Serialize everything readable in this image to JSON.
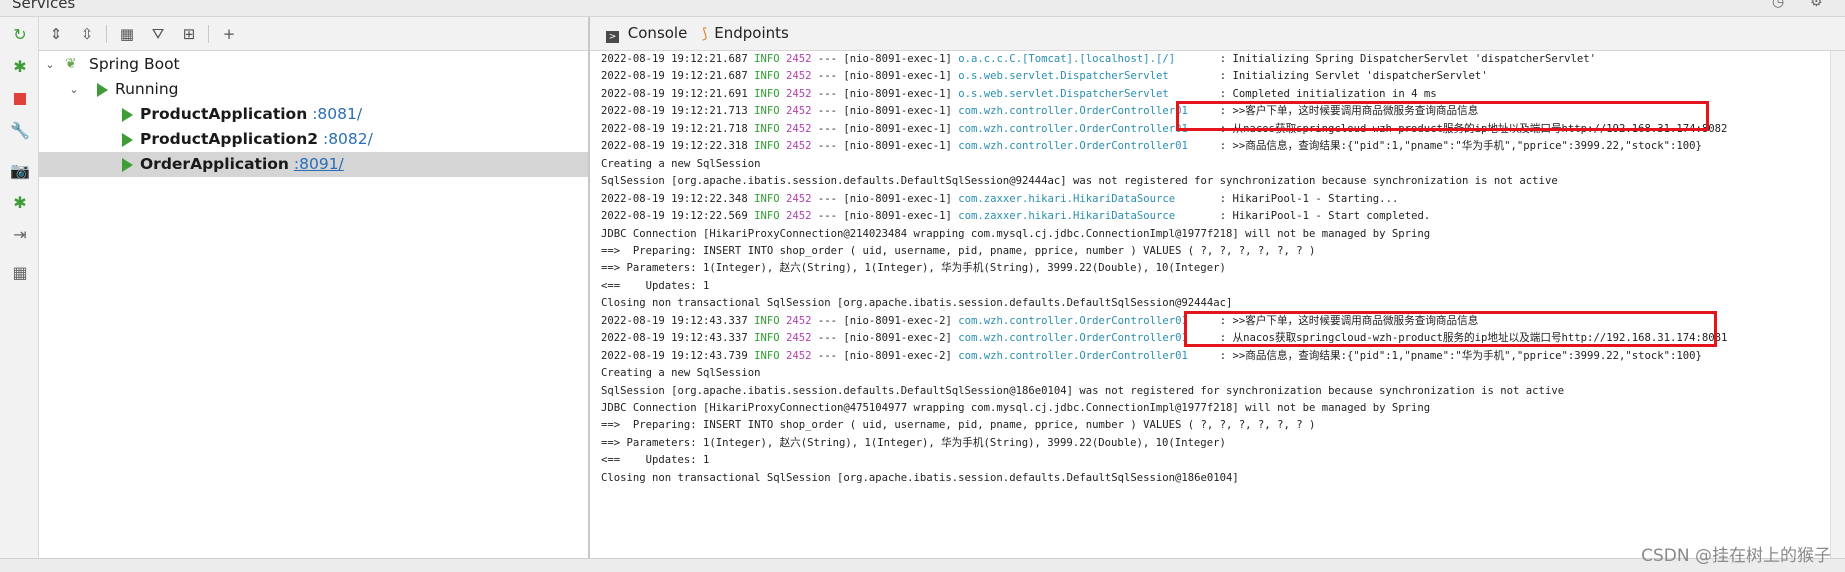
{
  "window": {
    "title": "Services"
  },
  "tree": {
    "root": {
      "label": "Spring Boot"
    },
    "group": {
      "label": "Running"
    },
    "apps": [
      {
        "name": "ProductApplication",
        "port": ":8081/"
      },
      {
        "name": "ProductApplication2",
        "port": ":8082/"
      },
      {
        "name": "OrderApplication",
        "port": ":8091/"
      }
    ]
  },
  "tabs": {
    "console": "Console",
    "endpoints": "Endpoints"
  },
  "log": [
    {
      "ts": "2022-08-19 19:12:21.687",
      "lvl": "INFO",
      "pid": "2452",
      "thr": "--- [nio-8091-exec-1]",
      "logger": "o.a.c.c.C.[Tomcat].[localhost].[/]      ",
      "msg": " : Initializing Spring DispatcherServlet 'dispatcherServlet'"
    },
    {
      "ts": "2022-08-19 19:12:21.687",
      "lvl": "INFO",
      "pid": "2452",
      "thr": "--- [nio-8091-exec-1]",
      "logger": "o.s.web.servlet.DispatcherServlet       ",
      "msg": " : Initializing Servlet 'dispatcherServlet'"
    },
    {
      "ts": "2022-08-19 19:12:21.691",
      "lvl": "INFO",
      "pid": "2452",
      "thr": "--- [nio-8091-exec-1]",
      "logger": "o.s.web.servlet.DispatcherServlet       ",
      "msg": " : Completed initialization in 4 ms"
    },
    {
      "ts": "2022-08-19 19:12:21.713",
      "lvl": "INFO",
      "pid": "2452",
      "thr": "--- [nio-8091-exec-1]",
      "logger": "com.wzh.controller.OrderController01    ",
      "msg": " : >>客户下单，这时候要调用商品微服务查询商品信息"
    },
    {
      "ts": "2022-08-19 19:12:21.718",
      "lvl": "INFO",
      "pid": "2452",
      "thr": "--- [nio-8091-exec-1]",
      "logger": "com.wzh.controller.OrderController01    ",
      "msg": " : 从nacos获取springcloud-wzh-product服务的ip地址以及端口号http://192.168.31.174:8082"
    },
    {
      "ts": "2022-08-19 19:12:22.318",
      "lvl": "INFO",
      "pid": "2452",
      "thr": "--- [nio-8091-exec-1]",
      "logger": "com.wzh.controller.OrderController01    ",
      "msg": " : >>商品信息，查询结果:{\"pid\":1,\"pname\":\"华为手机\",\"pprice\":3999.22,\"stock\":100}"
    },
    {
      "text": "Creating a new SqlSession"
    },
    {
      "text": "SqlSession [org.apache.ibatis.session.defaults.DefaultSqlSession@92444ac] was not registered for synchronization because synchronization is not active"
    },
    {
      "ts": "2022-08-19 19:12:22.348",
      "lvl": "INFO",
      "pid": "2452",
      "thr": "--- [nio-8091-exec-1]",
      "logger": "com.zaxxer.hikari.HikariDataSource      ",
      "msg": " : HikariPool-1 - Starting..."
    },
    {
      "ts": "2022-08-19 19:12:22.569",
      "lvl": "INFO",
      "pid": "2452",
      "thr": "--- [nio-8091-exec-1]",
      "logger": "com.zaxxer.hikari.HikariDataSource      ",
      "msg": " : HikariPool-1 - Start completed."
    },
    {
      "text": "JDBC Connection [HikariProxyConnection@214023484 wrapping com.mysql.cj.jdbc.ConnectionImpl@1977f218] will not be managed by Spring"
    },
    {
      "text": "==>  Preparing: INSERT INTO shop_order ( uid, username, pid, pname, pprice, number ) VALUES ( ?, ?, ?, ?, ?, ? )"
    },
    {
      "text": "==> Parameters: 1(Integer), 赵六(String), 1(Integer), 华为手机(String), 3999.22(Double), 10(Integer)"
    },
    {
      "text": "<==    Updates: 1"
    },
    {
      "text": "Closing non transactional SqlSession [org.apache.ibatis.session.defaults.DefaultSqlSession@92444ac]"
    },
    {
      "ts": "2022-08-19 19:12:43.337",
      "lvl": "INFO",
      "pid": "2452",
      "thr": "--- [nio-8091-exec-2]",
      "logger": "com.wzh.controller.OrderController01    ",
      "msg": " : >>客户下单，这时候要调用商品微服务查询商品信息"
    },
    {
      "ts": "2022-08-19 19:12:43.337",
      "lvl": "INFO",
      "pid": "2452",
      "thr": "--- [nio-8091-exec-2]",
      "logger": "com.wzh.controller.OrderController01    ",
      "msg": " : 从nacos获取springcloud-wzh-product服务的ip地址以及端口号http://192.168.31.174:8081"
    },
    {
      "ts": "2022-08-19 19:12:43.739",
      "lvl": "INFO",
      "pid": "2452",
      "thr": "--- [nio-8091-exec-2]",
      "logger": "com.wzh.controller.OrderController01    ",
      "msg": " : >>商品信息，查询结果:{\"pid\":1,\"pname\":\"华为手机\",\"pprice\":3999.22,\"stock\":100}"
    },
    {
      "text": "Creating a new SqlSession"
    },
    {
      "text": "SqlSession [org.apache.ibatis.session.defaults.DefaultSqlSession@186e0104] was not registered for synchronization because synchronization is not active"
    },
    {
      "text": "JDBC Connection [HikariProxyConnection@475104977 wrapping com.mysql.cj.jdbc.ConnectionImpl@1977f218] will not be managed by Spring"
    },
    {
      "text": "==>  Preparing: INSERT INTO shop_order ( uid, username, pid, pname, pprice, number ) VALUES ( ?, ?, ?, ?, ?, ? )"
    },
    {
      "text": "==> Parameters: 1(Integer), 赵六(String), 1(Integer), 华为手机(String), 3999.22(Double), 10(Integer)"
    },
    {
      "text": "<==    Updates: 1"
    },
    {
      "text": "Closing non transactional SqlSession [org.apache.ibatis.session.defaults.DefaultSqlSession@186e0104]"
    }
  ],
  "colors": {
    "highlight": "#e3141c",
    "run": "#3f9c36",
    "port": "#2a6fb6"
  },
  "watermark": "CSDN @挂在树上的猴子"
}
